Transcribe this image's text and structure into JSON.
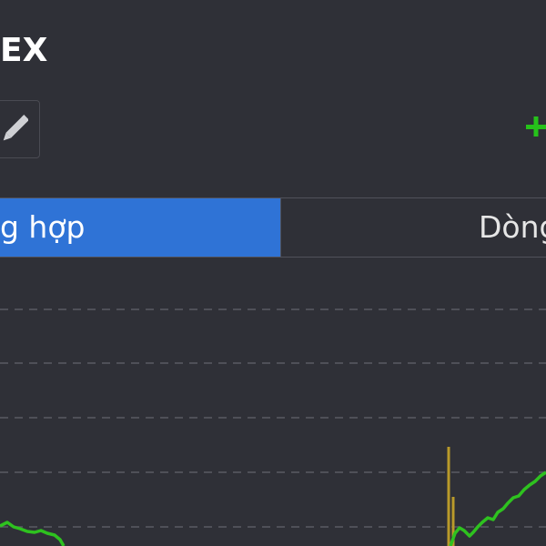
{
  "header": {
    "title": "EX"
  },
  "toolbar": {
    "edit_icon": "pencil-icon",
    "add_icon": "plus-icon"
  },
  "tabs": [
    {
      "label": "g hợp",
      "active": true
    },
    {
      "label": "Dòng",
      "active": false
    }
  ],
  "colors": {
    "background": "#2f3037",
    "active_tab": "#2f73d6",
    "line": "#2ec21f",
    "volume_spike": "#b99a2a",
    "add_icon": "#26c21a",
    "grid": "#5a5b63"
  }
}
